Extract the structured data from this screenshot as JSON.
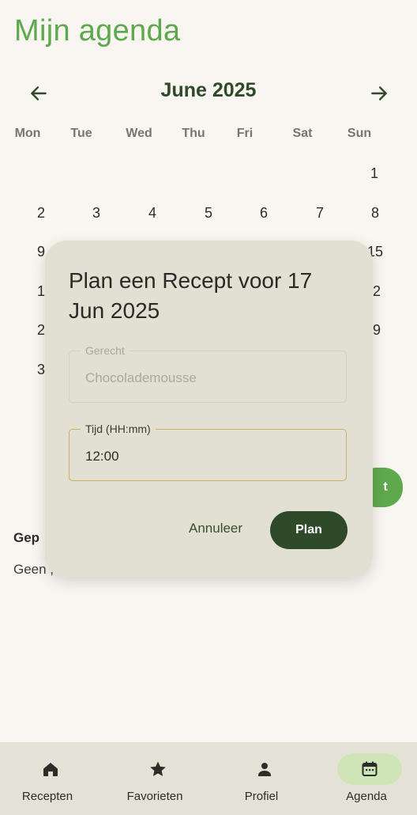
{
  "app": {
    "title": "Mijn agenda"
  },
  "calendar": {
    "month_label": "June 2025",
    "weekdays": [
      "Mon",
      "Tue",
      "Wed",
      "Thu",
      "Fri",
      "Sat",
      "Sun"
    ],
    "visible_days": {
      "row1": [
        "1"
      ],
      "row2": [
        "2",
        "3",
        "4",
        "5",
        "6",
        "7",
        "8"
      ],
      "row3_left": "9",
      "row3_right": "15",
      "row4_left": "1",
      "row4_right": "2",
      "row5_left": "2",
      "row5_right": "9",
      "row6_left": "3"
    }
  },
  "fab": {
    "partial_label": "t"
  },
  "section": {
    "title_partial": "Gep",
    "empty_partial": "Geen ,"
  },
  "dialog": {
    "title": "Plan een Recept voor 17 Jun 2025",
    "recipe_field": {
      "label": "Gerecht",
      "value": "Chocolademousse"
    },
    "time_field": {
      "label": "Tijd (HH:mm)",
      "value": "12:00"
    },
    "cancel_label": "Annuleer",
    "confirm_label": "Plan"
  },
  "bottom_nav": {
    "items": [
      {
        "label": "Recepten",
        "icon": "home-icon",
        "selected": false
      },
      {
        "label": "Favorieten",
        "icon": "star-icon",
        "selected": false
      },
      {
        "label": "Profiel",
        "icon": "person-icon",
        "selected": false
      },
      {
        "label": "Agenda",
        "icon": "calendar-icon",
        "selected": true
      }
    ]
  },
  "colors": {
    "accent": "#5ea84e",
    "primary_dark": "#2f4a28",
    "background": "#f9f5f0",
    "dialog_surface": "#e1e0d3",
    "nav_surface": "#e4e2d6",
    "selected_pill": "#cfe5b8",
    "focus_outline": "#cbaf66"
  }
}
